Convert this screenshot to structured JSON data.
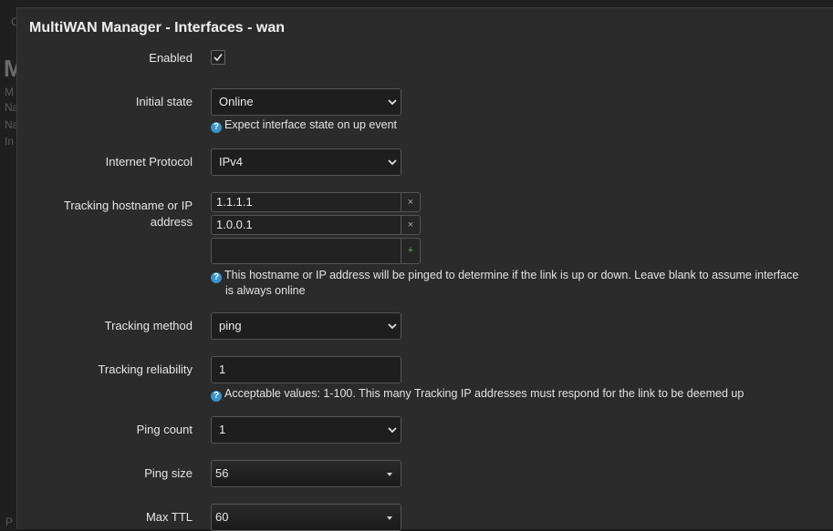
{
  "background": {
    "letters": [
      "C",
      "M",
      "M",
      "Na",
      "Na",
      "In",
      "P"
    ]
  },
  "modal": {
    "title": "MultiWAN Manager - Interfaces - wan"
  },
  "form": {
    "enabled": {
      "label": "Enabled",
      "checked": true
    },
    "initial_state": {
      "label": "Initial state",
      "value": "Online",
      "help": "Expect interface state on up event"
    },
    "internet_protocol": {
      "label": "Internet Protocol",
      "value": "IPv4"
    },
    "tracking_hosts": {
      "label": "Tracking hostname or IP address",
      "values": [
        "1.1.1.1",
        "1.0.0.1"
      ],
      "new_value": "",
      "remove_glyph": "×",
      "add_glyph": "+",
      "help_line1": "This hostname or IP address will be pinged to determine if the link is up or down. Leave blank to assume interface",
      "help_line2": "is always online"
    },
    "tracking_method": {
      "label": "Tracking method",
      "value": "ping"
    },
    "tracking_reliability": {
      "label": "Tracking reliability",
      "value": "1",
      "help": "Acceptable values: 1-100. This many Tracking IP addresses must respond for the link to be deemed up"
    },
    "ping_count": {
      "label": "Ping count",
      "value": "1"
    },
    "ping_size": {
      "label": "Ping size",
      "value": "56"
    },
    "max_ttl": {
      "label": "Max TTL",
      "value": "60"
    }
  },
  "colors": {
    "background": "#1b1b1b",
    "modal": "#2b2b2b",
    "help_icon": "#3a94c9",
    "add_button": "#6aa86a"
  },
  "icons": {
    "checkbox": "check-icon",
    "select": "chevron-down-icon",
    "help": "question-icon"
  }
}
